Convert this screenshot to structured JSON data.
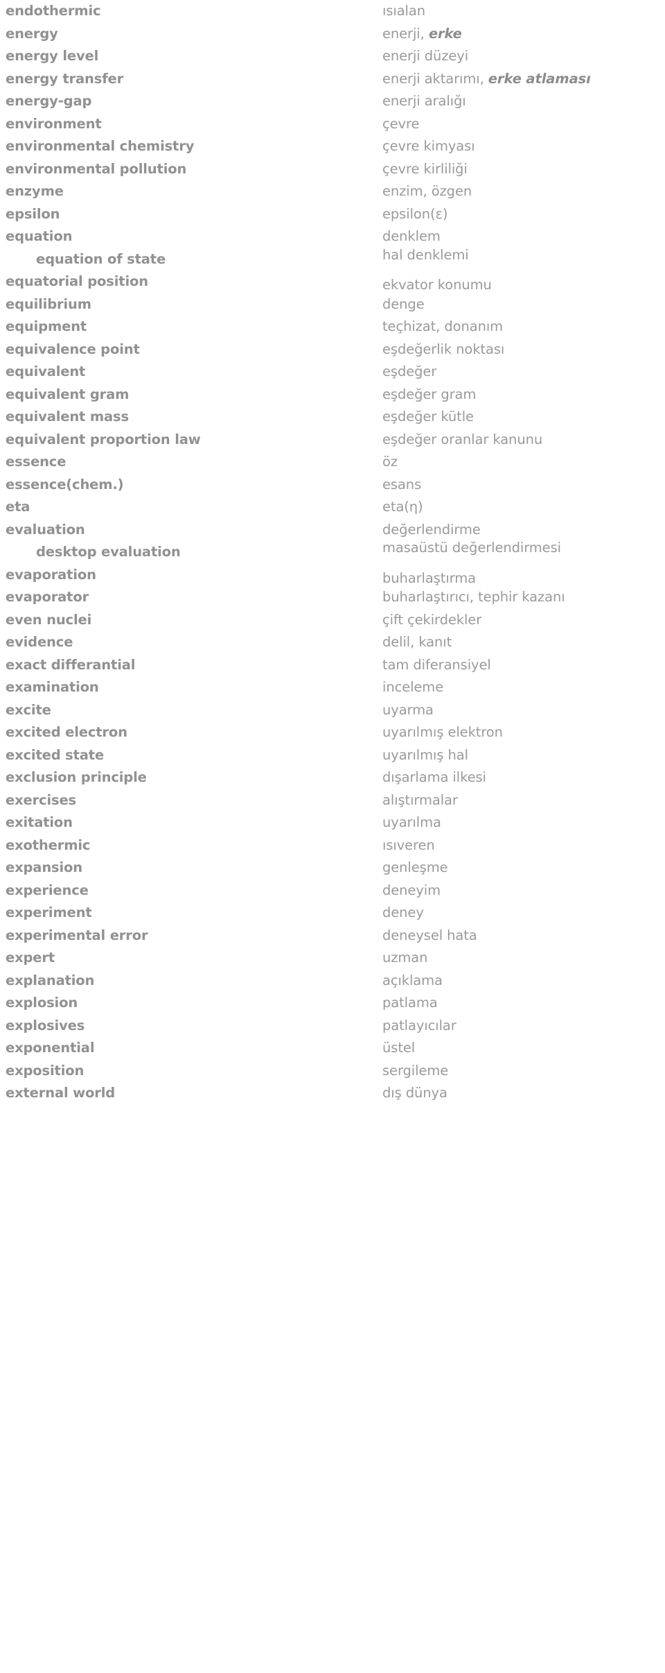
{
  "page": {
    "type": "bilingual-glossary",
    "source_language": "English",
    "target_language": "Turkish",
    "text_color": "#939393",
    "background_color": "#ffffff"
  },
  "entries": [
    {
      "source": "endothermic",
      "indent": false,
      "target_html": "ısıalan"
    },
    {
      "source": "energy",
      "indent": false,
      "target_html": "enerji, <em>erke</em>"
    },
    {
      "source": "energy level",
      "indent": false,
      "target_html": "enerji düzeyi"
    },
    {
      "source": "energy transfer",
      "indent": false,
      "target_html": "enerji aktarımı, <em>erke atlaması</em>"
    },
    {
      "source": "energy-gap",
      "indent": false,
      "target_html": "enerji aralığı"
    },
    {
      "source": "environment",
      "indent": false,
      "target_html": "çevre"
    },
    {
      "source": "environmental chemistry",
      "indent": false,
      "target_html": "çevre kimyası"
    },
    {
      "source": "environmental pollution",
      "indent": false,
      "target_html": "çevre kirliliği"
    },
    {
      "source": "enzyme",
      "indent": false,
      "target_html": "enzim, özgen"
    },
    {
      "source": "epsilon",
      "indent": false,
      "target_html": "epsilon(ε)"
    },
    {
      "source": "equation",
      "indent": false,
      "target_html": "denklem"
    },
    {
      "source": "equation of state",
      "indent": true,
      "target_html": "hal denklemi"
    },
    {
      "source": "equatorial position",
      "indent": false,
      "target_html": "ekvator konumu"
    },
    {
      "source": "equilibrium",
      "indent": false,
      "target_html": "denge"
    },
    {
      "source": "equipment",
      "indent": false,
      "target_html": "teçhizat, donanım"
    },
    {
      "source": "equivalence point",
      "indent": false,
      "target_html": "eşdeğerlik noktası"
    },
    {
      "source": "equivalent",
      "indent": false,
      "target_html": "eşdeğer"
    },
    {
      "source": "equivalent gram",
      "indent": false,
      "target_html": "eşdeğer gram"
    },
    {
      "source": "equivalent mass",
      "indent": false,
      "target_html": "eşdeğer kütle"
    },
    {
      "source": "equivalent proportion law",
      "indent": false,
      "target_html": "eşdeğer oranlar kanunu"
    },
    {
      "source": "essence",
      "indent": false,
      "target_html": "öz"
    },
    {
      "source": "essence(chem.)",
      "indent": false,
      "target_html": "esans"
    },
    {
      "source": "eta",
      "indent": false,
      "target_html": "eta(η)"
    },
    {
      "source": "evaluation",
      "indent": false,
      "target_html": "değerlendirme"
    },
    {
      "source": "desktop evaluation",
      "indent": true,
      "target_html": "masaüstü değerlendirmesi"
    },
    {
      "source": "evaporation",
      "indent": false,
      "target_html": "buharlaştırma"
    },
    {
      "source": "evaporator",
      "indent": false,
      "target_html": "buharlaştırıcı, tephir kazanı"
    },
    {
      "source": "even nuclei",
      "indent": false,
      "target_html": "çift çekirdekler"
    },
    {
      "source": "evidence",
      "indent": false,
      "target_html": "delil, kanıt"
    },
    {
      "source": "exact differantial",
      "indent": false,
      "target_html": "tam diferansiyel"
    },
    {
      "source": "examination",
      "indent": false,
      "target_html": "inceleme"
    },
    {
      "source": "excite",
      "indent": false,
      "target_html": "uyarma"
    },
    {
      "source": "excited electron",
      "indent": false,
      "target_html": "uyarılmış elektron"
    },
    {
      "source": "excited state",
      "indent": false,
      "target_html": "uyarılmış hal"
    },
    {
      "source": "exclusion principle",
      "indent": false,
      "target_html": "dışarlama ilkesi"
    },
    {
      "source": "exercises",
      "indent": false,
      "target_html": "alıştırmalar"
    },
    {
      "source": "exitation",
      "indent": false,
      "target_html": "uyarılma"
    },
    {
      "source": "exothermic",
      "indent": false,
      "target_html": "ısıveren"
    },
    {
      "source": "expansion",
      "indent": false,
      "target_html": "genleşme"
    },
    {
      "source": "experience",
      "indent": false,
      "target_html": "deneyim"
    },
    {
      "source": "experiment",
      "indent": false,
      "target_html": "deney"
    },
    {
      "source": "experimental error",
      "indent": false,
      "target_html": "deneysel hata"
    },
    {
      "source": "expert",
      "indent": false,
      "target_html": "uzman"
    },
    {
      "source": "explanation",
      "indent": false,
      "target_html": "açıklama"
    },
    {
      "source": "explosion",
      "indent": false,
      "target_html": "patlama"
    },
    {
      "source": "explosives",
      "indent": false,
      "target_html": "patlayıcılar"
    },
    {
      "source": "exponential",
      "indent": false,
      "target_html": "üstel"
    },
    {
      "source": "exposition",
      "indent": false,
      "target_html": "sergileme"
    },
    {
      "source": "external world",
      "indent": false,
      "target_html": "dış dünya"
    }
  ]
}
